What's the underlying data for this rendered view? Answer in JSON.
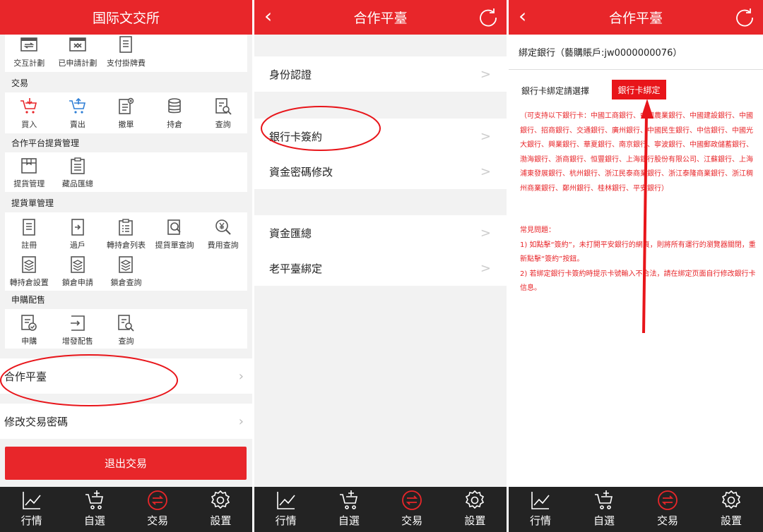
{
  "panel1": {
    "header": "国际文交所",
    "top_items": [
      "交互計劃",
      "已申請計劃",
      "支付掛牌費"
    ],
    "sections": [
      {
        "title": "交易",
        "items": [
          "買入",
          "賣出",
          "撤單",
          "持倉",
          "查詢"
        ]
      },
      {
        "title": "合作平台提貨管理",
        "items": [
          "提貨管理",
          "藏品匯總"
        ]
      },
      {
        "title": "提貨單管理",
        "items": [
          "註冊",
          "過戶",
          "轉持倉列表",
          "提貨單查詢",
          "費用查詢"
        ],
        "items2": [
          "轉持倉設置",
          "鎖倉申請",
          "鎖倉查詢"
        ]
      },
      {
        "title": "申購配售",
        "items": [
          "申購",
          "增發配售",
          "查詢"
        ]
      }
    ],
    "link_coop": "合作平臺",
    "link_pwd": "修改交易密碼",
    "logout": "退出交易"
  },
  "panel2": {
    "header": "合作平臺",
    "rows": [
      "身份認證",
      "銀行卡簽約",
      "資金密碼修改",
      "資金匯總",
      "老平臺綁定"
    ]
  },
  "panel3": {
    "header": "合作平臺",
    "bind_title": "綁定銀行（藝購賬戶:jw0000000076）",
    "bind_label": "銀行卡綁定請選擇",
    "bind_button": "銀行卡綁定",
    "bank_list": "（可支持以下銀行卡：中國工商銀行、中國農業銀行、中國建設銀行、中國銀行、招商銀行、交通銀行、廣州銀行、中國民生銀行、中信銀行、中國光大銀行、興業銀行、華夏銀行、南京銀行、寧波銀行、中國郵政儲蓄銀行、渤海銀行、浙商銀行、恒豐銀行、上海銀行股份有限公司、江蘇銀行、上海浦東發展銀行、杭州銀行、浙江民泰商業銀行、浙江泰隆商業銀行、浙江稠州商業銀行、鄭州銀行、桂林銀行、平安銀行）",
    "faq_title": "常見問題：",
    "faq1": "1) 如點擊“簽約”，未打開平安銀行的網頁，則將所有運行的瀏覽器關閉，重新點擊“簽約”按鈕。",
    "faq2": "2) 若綁定銀行卡簽約時提示卡號輸入不合法，請在綁定页面自行修改銀行卡信息。"
  },
  "tabbar": [
    "行情",
    "自選",
    "交易",
    "設置"
  ],
  "colors": {
    "accent": "#e8262a",
    "tabbar_bg": "#232323",
    "annotation": "#e8151a"
  }
}
